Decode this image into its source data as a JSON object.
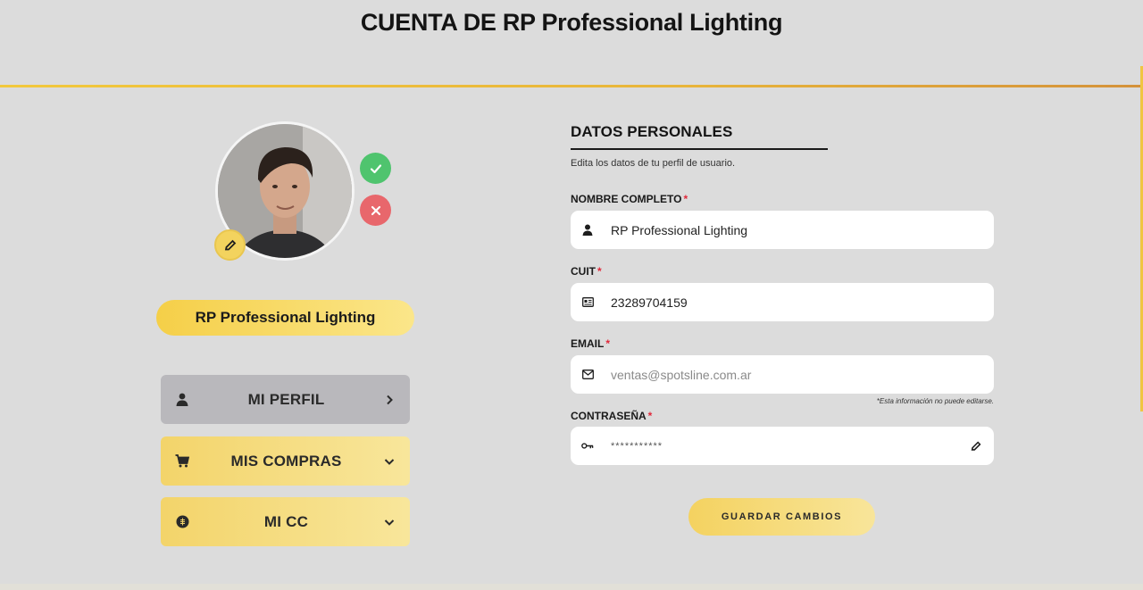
{
  "header": {
    "title": "CUENTA DE RP Professional Lighting"
  },
  "profile": {
    "name": "RP Professional Lighting",
    "avatar_alt": "avatar"
  },
  "menu": {
    "items": [
      {
        "label": "MI PERFIL",
        "icon": "user-icon",
        "arrow": "chevron-right-icon"
      },
      {
        "label": "MIS COMPRAS",
        "icon": "cart-icon",
        "arrow": "chevron-down-icon"
      },
      {
        "label": "MI CC",
        "icon": "coin-icon",
        "arrow": "chevron-down-icon"
      }
    ]
  },
  "form": {
    "section_title": "DATOS PERSONALES",
    "section_subtitle": "Edita los datos de tu perfil de usuario.",
    "fields": {
      "name": {
        "label": "NOMBRE COMPLETO",
        "value": "RP Professional Lighting",
        "icon": "user-icon"
      },
      "cuit": {
        "label": "CUIT",
        "value": "23289704159",
        "icon": "id-card-icon"
      },
      "email": {
        "label": "EMAIL",
        "value": "ventas@spotsline.com.ar",
        "icon": "mail-icon"
      },
      "password": {
        "label": "CONTRASEÑA",
        "value": "***********",
        "icon": "key-icon"
      }
    },
    "required_mark": "*",
    "note": "*Esta información no puede editarse.",
    "save_label": "GUARDAR CAMBIOS"
  },
  "colors": {
    "background": "#dcdcdc",
    "accent": "#f2c83c",
    "confirm": "#4fc46e",
    "cancel": "#e8676c"
  }
}
